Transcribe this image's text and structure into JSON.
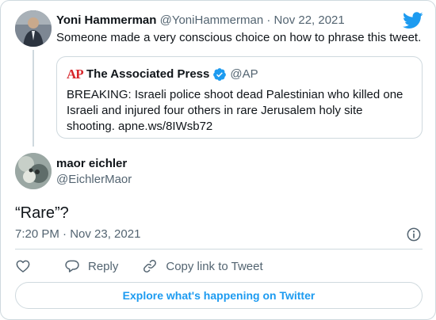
{
  "parent_tweet": {
    "author_name": "Yoni Hammerman",
    "author_handle": "@YoniHammerman",
    "separator": "·",
    "date": "Nov 22, 2021",
    "text": "Someone made a very conscious choice on how to phrase this tweet."
  },
  "quoted_tweet": {
    "logo_text": "AP",
    "author_name": "The Associated Press",
    "author_handle": "@AP",
    "text_lines": [
      "BREAKING: Israeli police shoot dead Palestinian who killed one",
      "Israeli and injured four others in rare Jerusalem holy site",
      "shooting. apne.ws/8IWsb72"
    ]
  },
  "reply_tweet": {
    "author_name": "maor eichler",
    "author_handle": "@EichlerMaor",
    "text": "“Rare”?",
    "timestamp": "7:20 PM · Nov 23, 2021"
  },
  "actions": {
    "reply_label": "Reply",
    "copy_link_label": "Copy link to Tweet"
  },
  "footer": {
    "explore_label": "Explore what's happening on Twitter"
  },
  "colors": {
    "twitter_blue": "#1d9bf0",
    "verified_blue": "#1d9bf0",
    "muted_text": "#536471",
    "border": "#cfd9de",
    "ap_red": "#d7262b"
  },
  "icons": {
    "brand": "twitter-bird-icon",
    "verified": "verified-badge-icon",
    "info": "info-icon",
    "like": "heart-icon",
    "reply": "speech-bubble-icon",
    "copy_link": "link-icon"
  }
}
